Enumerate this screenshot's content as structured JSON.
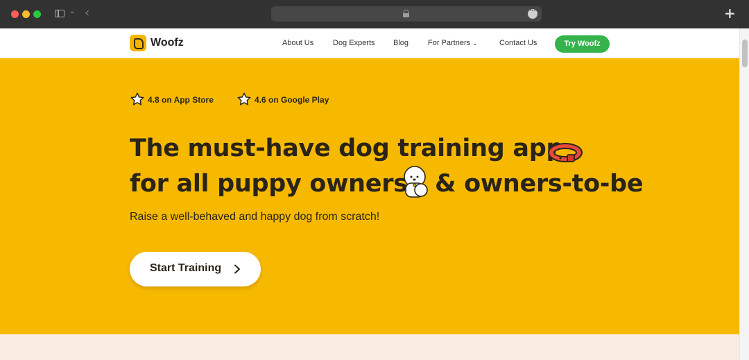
{
  "browser": {
    "icons": [
      "sidebar-toggle-icon",
      "chevron-down-icon",
      "back-icon",
      "lock-icon",
      "more-icon",
      "plus-icon"
    ],
    "new_tab_glyph": "+"
  },
  "nav": {
    "logo_text": "Woofz",
    "links": [
      "About Us",
      "Dog Experts",
      "Blog",
      "For Partners",
      "Contact Us"
    ],
    "cta_label": "Try Woofz",
    "colors": {
      "cta": "#34b44a",
      "logo": "#f7b500"
    }
  },
  "hero": {
    "ratings": [
      {
        "label": "4.8 on App Store"
      },
      {
        "label": "4.6 on Google Play"
      }
    ],
    "headline_line1": "The must-have dog training app",
    "headline_line2_a": "for all puppy owners",
    "headline_line2_b": "& owners-to-be",
    "subtitle": "Raise a well-behaved and happy dog from scratch!",
    "cta_label": "Start Training",
    "background": "#f7b900"
  }
}
